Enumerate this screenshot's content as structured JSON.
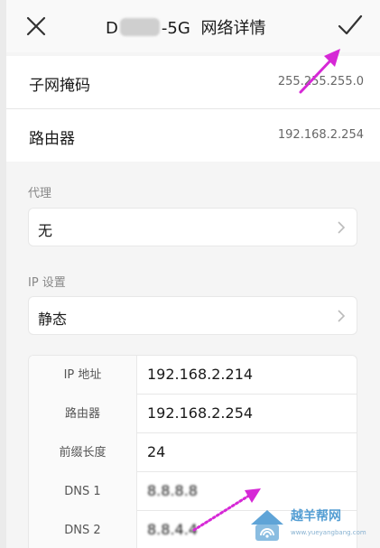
{
  "header": {
    "title_prefix": "D",
    "title_suffix": "-5G",
    "title_main": "网络详情",
    "icons": {
      "close": "close-icon",
      "confirm": "check-icon"
    }
  },
  "info_rows": [
    {
      "label": "子网掩码",
      "value": "255.255.255.0"
    },
    {
      "label": "路由器",
      "value": "192.168.2.254"
    }
  ],
  "proxy": {
    "section_label": "代理",
    "value": "无"
  },
  "ip_settings": {
    "section_label": "IP 设置",
    "value": "静态"
  },
  "ip_table": [
    {
      "key": "IP 地址",
      "value": "192.168.2.214"
    },
    {
      "key": "路由器",
      "value": "192.168.2.254"
    },
    {
      "key": "前缀长度",
      "value": "24"
    },
    {
      "key": "DNS 1",
      "value": "8.8.8.8"
    },
    {
      "key": "DNS 2",
      "value": "8.8.4.4"
    }
  ],
  "watermark": {
    "title": "越羊帮网",
    "url": "www.yueyangbang.com"
  },
  "colors": {
    "annotation_arrow": "#d628d6",
    "watermark": "#2a86c9"
  }
}
